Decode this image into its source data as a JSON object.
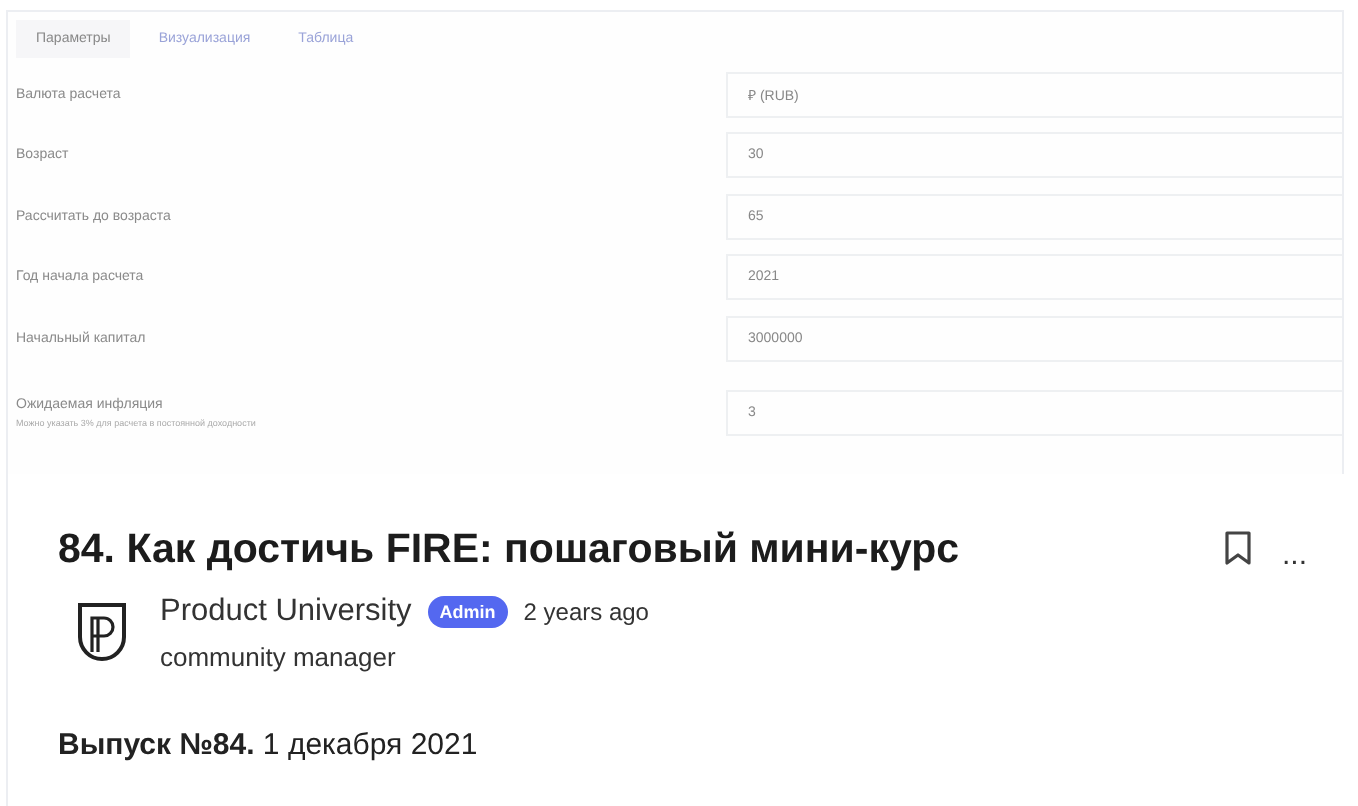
{
  "embedded_screenshot": {
    "tabs": [
      {
        "label": "Параметры",
        "selected": true
      },
      {
        "label": "Визуализация",
        "selected": false
      },
      {
        "label": "Таблица",
        "selected": false
      }
    ],
    "fields": [
      {
        "label": "Валюта расчета",
        "value": "₽ (RUB)"
      },
      {
        "label": "Возраст",
        "value": "30"
      },
      {
        "label": "Рассчитать до возраста",
        "value": "65"
      },
      {
        "label": "Год начала расчета",
        "value": "2021"
      },
      {
        "label": "Начальный капитал",
        "value": "3000000"
      },
      {
        "label": "Ожидаемая инфляция",
        "hint": "Можно указать 3% для расчета в постоянной доходности",
        "value": "3"
      }
    ]
  },
  "post": {
    "title": "84. Как достичь FIRE: пошаговый мини-курс",
    "author": "Product University",
    "badge": "Admin",
    "time": "2 years ago",
    "role": "community manager",
    "more": "...",
    "intro": "**Выпуск №84.** 1 декабря 2021"
  }
}
